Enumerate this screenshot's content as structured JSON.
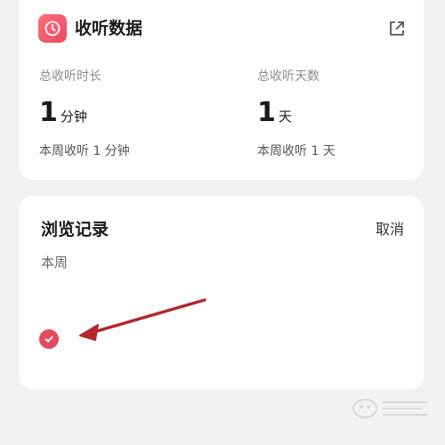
{
  "stats_card": {
    "title": "收听数据",
    "icon": "clock-icon",
    "share_icon": "share-external-icon",
    "total_duration": {
      "label": "总收听时长",
      "value": "1",
      "unit": "分钟",
      "sub": "本周收听 1 分钟"
    },
    "total_days": {
      "label": "总收听天数",
      "value": "1",
      "unit": "天",
      "sub": "本周收听 1 天"
    }
  },
  "history_card": {
    "title": "浏览记录",
    "cancel_label": "取消",
    "section_label": "本周",
    "check_icon": "check-circle-icon"
  },
  "colors": {
    "accent": "#e24a60",
    "background": "#f2f2f4",
    "card": "#ffffff",
    "arrow": "#b3262d"
  }
}
